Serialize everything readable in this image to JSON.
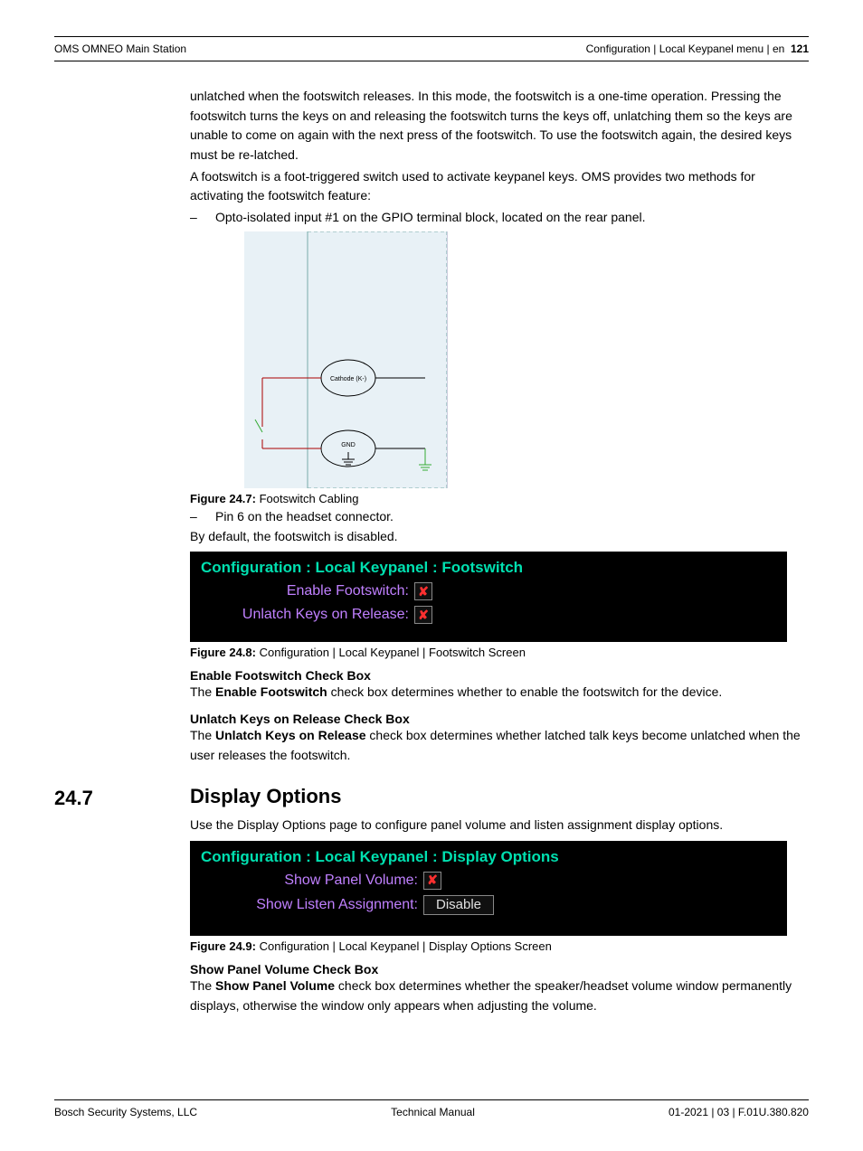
{
  "header": {
    "left": "OMS OMNEO Main Station",
    "right_text": "Configuration | Local Keypanel menu | en",
    "page_number": "121"
  },
  "body": {
    "p1": "unlatched when the footswitch releases. In this mode, the footswitch is a one-time operation. Pressing the footswitch turns the keys on and releasing the footswitch turns the keys off, unlatching them so the keys are unable to come on again with the next press of the footswitch. To use the footswitch again, the desired keys must be re-latched.",
    "p2": "A footswitch is a foot-triggered switch used to activate keypanel keys. OMS provides two methods for activating the footswitch feature:",
    "bullet1": "Opto-isolated input #1 on the GPIO terminal block, located on the rear panel.",
    "diagram_labels": {
      "cathode": "Cathode (K-)",
      "gnd": "GND"
    },
    "fig1_label": "Figure 24.7:",
    "fig1_text": "Footswitch Cabling",
    "bullet2": "Pin 6 on the headset connector.",
    "p3": "By default, the footswitch is disabled.",
    "screen1": {
      "title": "Configuration : Local Keypanel : Footswitch",
      "row1_label": "Enable Footswitch:",
      "row1_value": "✘",
      "row2_label": "Unlatch Keys on Release:",
      "row2_value": "✘"
    },
    "fig2_label": "Figure 24.8:",
    "fig2_text": "Configuration | Local Keypanel | Footswitch Screen",
    "sub1_head": "Enable Footswitch Check Box",
    "sub1_text_a": "The ",
    "sub1_text_b": "Enable Footswitch",
    "sub1_text_c": " check box determines whether to enable the footswitch for the device.",
    "sub2_head": "Unlatch Keys on Release Check Box",
    "sub2_text_a": "The ",
    "sub2_text_b": "Unlatch Keys on Release",
    "sub2_text_c": " check box determines whether latched talk keys become unlatched when the user releases the footswitch.",
    "section_num": "24.7",
    "section_title": "Display Options",
    "p4": "Use the Display Options page to configure panel volume and listen assignment display options.",
    "screen2": {
      "title": "Configuration : Local Keypanel : Display Options",
      "row1_label": "Show Panel Volume:",
      "row1_value": "✘",
      "row2_label": "Show Listen Assignment:",
      "row2_value": "Disable"
    },
    "fig3_label": "Figure 24.9:",
    "fig3_text": "Configuration | Local Keypanel | Display Options Screen",
    "sub3_head": "Show Panel Volume Check Box",
    "sub3_text_a": "The ",
    "sub3_text_b": "Show Panel Volume",
    "sub3_text_c": " check box determines whether the speaker/headset volume window permanently displays, otherwise the window only appears when adjusting the volume."
  },
  "footer": {
    "left": "Bosch Security Systems, LLC",
    "center": "Technical Manual",
    "right": "01-2021 | 03 | F.01U.380.820"
  }
}
